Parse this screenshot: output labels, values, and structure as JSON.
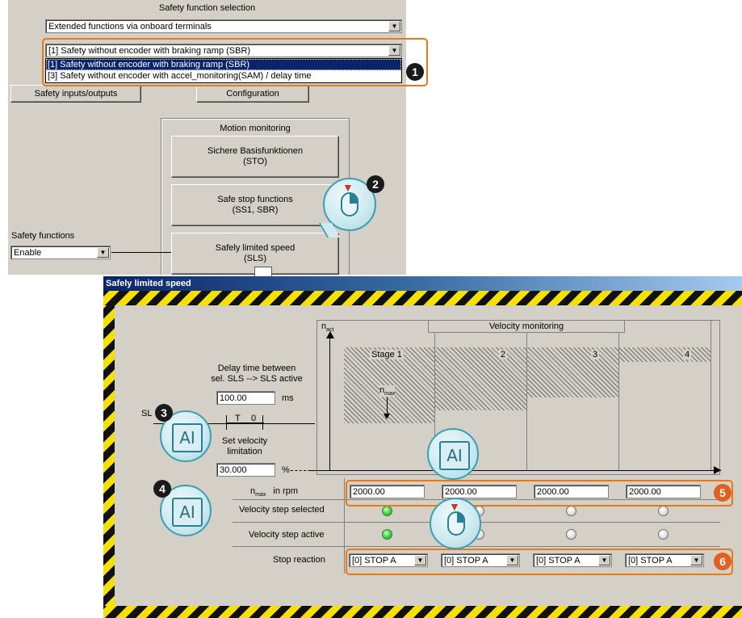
{
  "top_panel": {
    "title": "Safety function selection",
    "function_select": "Extended functions via onboard terminals",
    "mode_select": "[1] Safety without encoder with braking ramp (SBR)",
    "mode_options": [
      "[1] Safety without encoder with braking ramp (SBR)",
      "[3] Safety without encoder with accel_monitoring(SAM) / delay time"
    ],
    "btn_io": "Safety inputs/outputs",
    "btn_config": "Configuration",
    "motion_title": "Motion monitoring",
    "btn_basic_1": "Sichere Basisfunktionen",
    "btn_basic_2": "(STO)",
    "btn_stop_1": "Safe stop functions",
    "btn_stop_2": "(SS1, SBR)",
    "btn_sls_1": "Safely limited speed",
    "btn_sls_2": "(SLS)",
    "safety_functions_label": "Safety functions",
    "safety_functions_value": "Enable"
  },
  "sls_window": {
    "title": "Safely limited speed",
    "delay_1": "Delay time between",
    "delay_2": "sel. SLS --> SLS active",
    "delay_value": "100.00",
    "delay_unit": "ms",
    "sl_label": "SL",
    "timer_t": "T",
    "timer_0": "0",
    "set_vel_1": "Set velocity",
    "set_vel_2": "limitation",
    "limit_value": "30.000",
    "limit_unit": "%",
    "nact": "n",
    "nact_sub": "act",
    "nmax": "n",
    "nmax_sub": "max",
    "velocity_monitoring": "Velocity monitoring",
    "stages": [
      "Stage 1",
      "2",
      "3",
      "4"
    ],
    "nmax_row_label": "n",
    "nmax_row_sub": "max",
    "nmax_row_unit": "in  rpm",
    "nmax_values": [
      "2000.00",
      "2000.00",
      "2000.00",
      "2000.00"
    ],
    "step_selected": "Velocity step selected",
    "step_active": "Velocity step active",
    "stop_reaction": "Stop reaction",
    "stop_values": [
      "[0] STOP A",
      "[0] STOP A",
      "[0] STOP A",
      "[0] STOP A"
    ]
  },
  "callouts": [
    "1",
    "2",
    "3",
    "4",
    "5",
    "6"
  ],
  "icons": {
    "ai": "AI",
    "arrow_down": "▼"
  },
  "colors": {
    "panel": "#d4d0c8",
    "title_bar": "#0a246a",
    "highlight": "#e07b1f",
    "callout_orange": "#e0601f"
  }
}
